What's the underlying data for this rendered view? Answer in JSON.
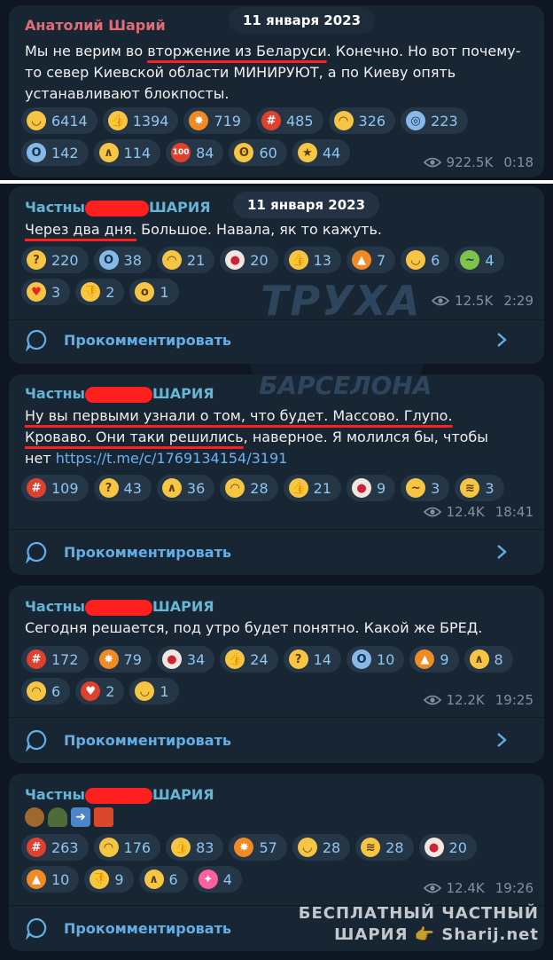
{
  "watermark": {
    "center_top": "ТРУХА",
    "center_bottom": "БАРСЕЛОНА",
    "corner_line1": "БЕСПЛАТНЫЙ ЧАСТНЫЙ",
    "corner_line2": "ШАРИЯ 👉 Sharij.net"
  },
  "posts": [
    {
      "author": "Анатолий Шарий",
      "date": "11 января 2023",
      "text_parts": [
        "Мы не верим во ",
        "вторжение из Беларуси",
        ". Конечно. Но вот почему-то север Киевской области МИНИРУЮТ, а по Киеву опять устанавливают блокпосты."
      ],
      "reactions": [
        {
          "icon": "grin-face-icon",
          "count": "6414"
        },
        {
          "icon": "thumbs-up-icon",
          "count": "1394"
        },
        {
          "icon": "exploding-head-icon",
          "count": "719"
        },
        {
          "icon": "cursing-face-icon",
          "count": "485"
        },
        {
          "icon": "crying-face-icon",
          "count": "326"
        },
        {
          "icon": "anxious-face-icon",
          "count": "223"
        },
        {
          "icon": "screaming-face-icon",
          "count": "142"
        },
        {
          "icon": "folded-hands-icon",
          "count": "114"
        },
        {
          "icon": "hundred-points-icon",
          "count": "84"
        },
        {
          "icon": "ok-hand-icon",
          "count": "60"
        },
        {
          "icon": "star-struck-icon",
          "count": "44"
        }
      ],
      "views": "922.5K",
      "time": "0:18"
    },
    {
      "author_left": "Частны",
      "author_right": "ШАРИЯ",
      "date": "11 января 2023",
      "text_parts": [
        "Через два дня.",
        " Большое. Навала, як то кажуть."
      ],
      "reactions": [
        {
          "icon": "thinking-face-icon",
          "count": "220"
        },
        {
          "icon": "screaming-face-icon",
          "count": "38"
        },
        {
          "icon": "crying-face-icon",
          "count": "21"
        },
        {
          "icon": "clown-face-icon",
          "count": "20"
        },
        {
          "icon": "thumbs-up-icon",
          "count": "13"
        },
        {
          "icon": "fire-icon",
          "count": "7"
        },
        {
          "icon": "grin-face-icon",
          "count": "6"
        },
        {
          "icon": "vomiting-face-icon",
          "count": "4"
        },
        {
          "icon": "heart-eyes-icon",
          "count": "3"
        },
        {
          "icon": "thumbs-down-icon",
          "count": "2"
        },
        {
          "icon": "yawning-face-icon",
          "count": "1"
        }
      ],
      "views": "12.5K",
      "time": "2:29",
      "comment_label": "Прокомментировать"
    },
    {
      "author_left": "Частны",
      "author_right": "ШАРИЯ",
      "text_line1": "Ну вы первыми узнали о том, что будет. Массово. Глупо.",
      "text_line2_ul": "Кроваво. Они таки решились",
      "text_line2_rest": ", наверное. Я молился бы, чтобы",
      "text_line3_prefix": "нет ",
      "link": "https://t.me/c/1769134154/3191",
      "reactions": [
        {
          "icon": "cursing-face-icon",
          "count": "109"
        },
        {
          "icon": "thinking-face-icon",
          "count": "43"
        },
        {
          "icon": "folded-hands-icon",
          "count": "36"
        },
        {
          "icon": "crying-face-icon",
          "count": "28"
        },
        {
          "icon": "thumbs-up-icon",
          "count": "21"
        },
        {
          "icon": "clown-face-icon",
          "count": "9"
        },
        {
          "icon": "woozy-face-icon",
          "count": "3"
        },
        {
          "icon": "rofl-face-icon",
          "count": "3"
        }
      ],
      "views": "12.4K",
      "time": "18:41",
      "comment_label": "Прокомментировать"
    },
    {
      "author_left": "Частны",
      "author_right": "ШАРИЯ",
      "text": "Сегодня решается, под утро будет понятно. Какой же БРЕД.",
      "reactions": [
        {
          "icon": "cursing-face-icon",
          "count": "172"
        },
        {
          "icon": "exploding-head-icon",
          "count": "79"
        },
        {
          "icon": "clown-face-icon",
          "count": "34"
        },
        {
          "icon": "thumbs-up-icon",
          "count": "24"
        },
        {
          "icon": "thinking-face-icon",
          "count": "14"
        },
        {
          "icon": "screaming-face-icon",
          "count": "10"
        },
        {
          "icon": "fire-icon",
          "count": "9"
        },
        {
          "icon": "folded-hands-icon",
          "count": "8"
        },
        {
          "icon": "crying-face-icon",
          "count": "6"
        },
        {
          "icon": "broken-heart-icon",
          "count": "2"
        },
        {
          "icon": "grin-face-icon",
          "count": "1"
        }
      ],
      "views": "12.2K",
      "time": "19:25",
      "comment_label": "Прокомментировать"
    },
    {
      "author_left": "Частны",
      "author_right": "ШАРИЯ",
      "emoji_line": [
        "potato-icon",
        "helmet-icon",
        "arrow-right-icon",
        "city-fire-icon"
      ],
      "reactions": [
        {
          "icon": "cursing-face-icon",
          "count": "263"
        },
        {
          "icon": "crying-face-icon",
          "count": "176"
        },
        {
          "icon": "thumbs-up-icon",
          "count": "83"
        },
        {
          "icon": "exploding-head-icon",
          "count": "57"
        },
        {
          "icon": "grin-face-icon",
          "count": "28"
        },
        {
          "icon": "rofl-face-icon",
          "count": "28"
        },
        {
          "icon": "clown-face-icon",
          "count": "20"
        },
        {
          "icon": "fire-icon",
          "count": "10"
        },
        {
          "icon": "thumbs-down-icon",
          "count": "9"
        },
        {
          "icon": "folded-hands-icon",
          "count": "6"
        },
        {
          "icon": "party-popper-icon",
          "count": "4"
        }
      ],
      "views": "12.4K",
      "time": "19:26",
      "comment_label": "Прокомментировать"
    }
  ]
}
